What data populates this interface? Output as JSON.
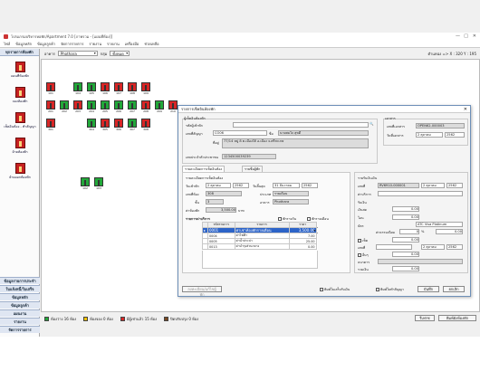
{
  "window": {
    "title": "โปรแกรมบริหารหอพัก/Apartment 7.0 [ภาพรวม - [แผนที่ห้อง]]",
    "controls": [
      "—",
      "□",
      "✕"
    ]
  },
  "menu": [
    "ไฟล์",
    "ข้อมูลหลัก",
    "ข้อมูลลูกค้า",
    "จัดการรายการ",
    "รายงาน",
    "รายงาน",
    "เครื่องมือ",
    "ช่วยเหลือ"
  ],
  "sidebar": {
    "header": "ทุกรายการห้องพัก",
    "items": [
      {
        "label": "แผนที่ห้องพัก"
      },
      {
        "label": "จองห้องพัก"
      },
      {
        "label": "เช็คอินห้อง - ทำสัญญา"
      },
      {
        "label": "ย้ายห้องพัก"
      },
      {
        "label": "ย้ายออกห้องพัก"
      }
    ],
    "footers": [
      "ข้อมูลรายการประจำ",
      "ใบแจ้งหนี้/ใบเสร็จ",
      "ข้อมูลหลัก",
      "ข้อมูลลูกค้า",
      "แผนงาน",
      "รายงาน",
      "จัดการรายการ"
    ]
  },
  "filter": {
    "building_label": "อาคาร",
    "building_value": "Phothara",
    "floor_label": "กลุ่ม",
    "floor_value": "ทั้งหมด",
    "coord": "ตำแหน่ง => X : 320 Y : 195"
  },
  "rooms": {
    "row1": [
      {
        "num": "101",
        "color": "red"
      },
      {
        "num": "",
        "color": "none"
      },
      {
        "num": "104",
        "color": "green"
      },
      {
        "num": "105",
        "color": "green"
      },
      {
        "num": "106",
        "color": "red"
      },
      {
        "num": "107",
        "color": "red"
      },
      {
        "num": "108",
        "color": "red"
      },
      {
        "num": "109",
        "color": "red"
      }
    ],
    "row2": [
      {
        "num": "201",
        "color": "red"
      },
      {
        "num": "202",
        "color": "green"
      },
      {
        "num": "203",
        "color": "red"
      },
      {
        "num": "204",
        "color": "green"
      },
      {
        "num": "205",
        "color": "green"
      },
      {
        "num": "206",
        "color": "green"
      },
      {
        "num": "207",
        "color": "green"
      },
      {
        "num": "208",
        "color": "red"
      },
      {
        "num": "209",
        "color": "green"
      },
      {
        "num": "210",
        "color": "red"
      }
    ],
    "row3": [
      {
        "num": "301",
        "color": "red"
      },
      {
        "num": "",
        "color": "none"
      },
      {
        "num": "",
        "color": "none"
      },
      {
        "num": "304",
        "color": "green"
      },
      {
        "num": "305",
        "color": "red"
      },
      {
        "num": "306",
        "color": "red"
      },
      {
        "num": "307",
        "color": "green"
      },
      {
        "num": "308",
        "color": "red"
      }
    ],
    "row4": [
      {
        "num": "102",
        "color": "green"
      },
      {
        "num": "103",
        "color": "green"
      }
    ]
  },
  "legend": {
    "items": [
      {
        "label": "ห้องว่าง 16 ห้อง",
        "color": "#22a83a"
      },
      {
        "label": "ห้องจอง 0 ห้อง",
        "color": "#f2c200"
      },
      {
        "label": "มีผู้เช่าแล้ว 15 ห้อง",
        "color": "#d82626"
      },
      {
        "label": "ปิดปรับปรุง 0 ห้อง",
        "color": "#7a4a22"
      }
    ],
    "refresh": "รีเฟรช",
    "print": "พิมพ์ผังห้องพัก"
  },
  "dialog": {
    "title": "รายการเช็คอินห้องพัก",
    "tenant_section": "ผู้เช็คอินห้องพัก",
    "tenant_code_label": "รหัสผู้เข้าพัก",
    "contract_label": "เลขที่สัญญา",
    "contract_value": "CO06",
    "name_label": "ชื่อ",
    "name_value": "นายสมใจ สุขดี",
    "address_label": "ที่อยู่",
    "address_value": "77/14 หมู่ 8 ต.เมืองใต้ อ.เมือง จ.ศรีสะเกษ",
    "id_label": "เลขประจำตัวประชาชน",
    "id_value": "1234500039239",
    "doc_section": "เอกสาร",
    "doc_no_label": "เลขที่เอกสาร",
    "doc_no_value": "OPEN62-000003",
    "doc_date_label": "วันที่เอกสาร",
    "doc_date_value": "2  ตุลาคม",
    "doc_year": "2562",
    "tabs": [
      "รายละเอียดการเช็คอินห้อง",
      "รายชื่อผู้พัก"
    ],
    "stay_section": "รายละเอียดการเช็คอินห้อง",
    "start_label": "วันเข้าพัก",
    "start_value": "2  ตุลาคม",
    "start_year": "2562",
    "end_label": "วันสิ้นสุด",
    "end_value": "31  ธันวาคม",
    "end_year": "2562",
    "room_label": "เลขที่ห้อง",
    "room_value": "308",
    "type_label": "ประเภท",
    "type_value": "รายเดือน",
    "floor_label": "ชั้น",
    "floor_value": "3",
    "building_label": "อาคาร",
    "building_value": "Phothara",
    "rent_label": "ค่าห้องพัก",
    "rent_value": "3,500.00",
    "rent_unit": "บาท",
    "services_label": "รายการค่าบริการ",
    "options": [
      "พักรายวัน",
      "พักรายเดือน"
    ],
    "services_header": [
      "รหัสรายการ",
      "รายการ",
      "ราคา"
    ],
    "services": [
      {
        "code": "0001",
        "name": "ค่าเช่าห้องพักรายเดือน",
        "price": "3,500.00"
      },
      {
        "code": "0004",
        "name": "ค่าไฟฟ้า",
        "price": "7.00"
      },
      {
        "code": "0005",
        "name": "ค่าน้ำประปา",
        "price": "25.00"
      },
      {
        "code": "0013",
        "name": "ค่าบำรุงส่วนกลาง",
        "price": "0.00"
      }
    ],
    "pay_section": "รายรับเงินเงิน",
    "pay_doc_label": "เลขที่",
    "pay_doc_value": "RV6910-000001",
    "pay_date_value": "2  ตุลาคม",
    "pay_year": "2562",
    "pay_type_label": "ค่าบริการ",
    "recv_label": "รับเงิน",
    "cash_label": "เงินสด",
    "cash_value": "0.00",
    "transfer_label": "โอน",
    "transfer_value": "0.00",
    "card_label": "บัตร",
    "card_type_value": "ATC Visa Platinum",
    "fee_label": "ค่าธรรมเนียม",
    "fee_value": "0",
    "fee_unit": "%",
    "fee_amount": "0.00",
    "cheque_label": "เช็ค",
    "cheque_value": "0.00",
    "cheque_no_label": "เลขที่",
    "cheque_date_value": "2  ตุลาคม",
    "cheque_year": "2562",
    "other_label": "อื่นๆ",
    "other_value": "0.00",
    "bank_label": "ธนาคาร",
    "total_label": "รวมเงิน",
    "total_value": "0.00",
    "note_label": "หมายเหตุ",
    "edit_btn": "ลงทะเบียน/แก้ไขผู้พัก",
    "print_check": "พิมพ์ใบเสร็จรับเงิน",
    "print_contract": "พิมพ์ใบทำสัญญา",
    "save_btn": "บันทึก",
    "cancel_btn": "ยกเลิก"
  }
}
